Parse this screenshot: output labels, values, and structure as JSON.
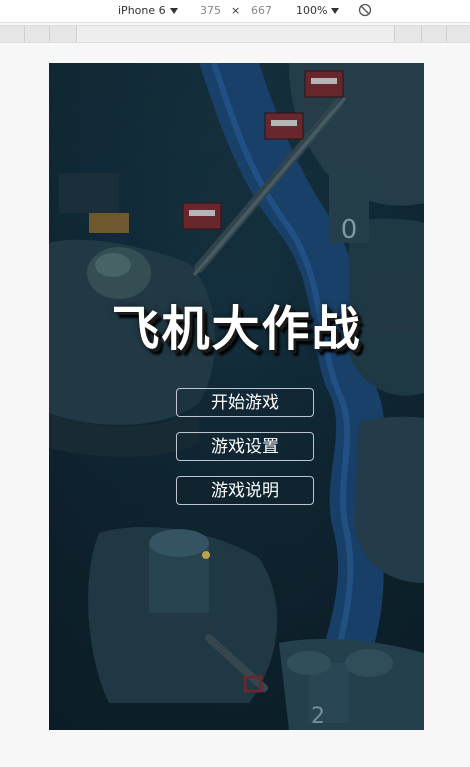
{
  "devtools": {
    "device": "iPhone 6",
    "width": "375",
    "times": "×",
    "height": "667",
    "zoom": "100%"
  },
  "game": {
    "title": "飞机大作战",
    "buttons": [
      "开始游戏",
      "游戏设置",
      "游戏说明"
    ]
  },
  "colors": {
    "background_dark": "#122a38",
    "water": "#1f4f8a",
    "button_border": "#dce1eb",
    "title": "#ffffff"
  }
}
